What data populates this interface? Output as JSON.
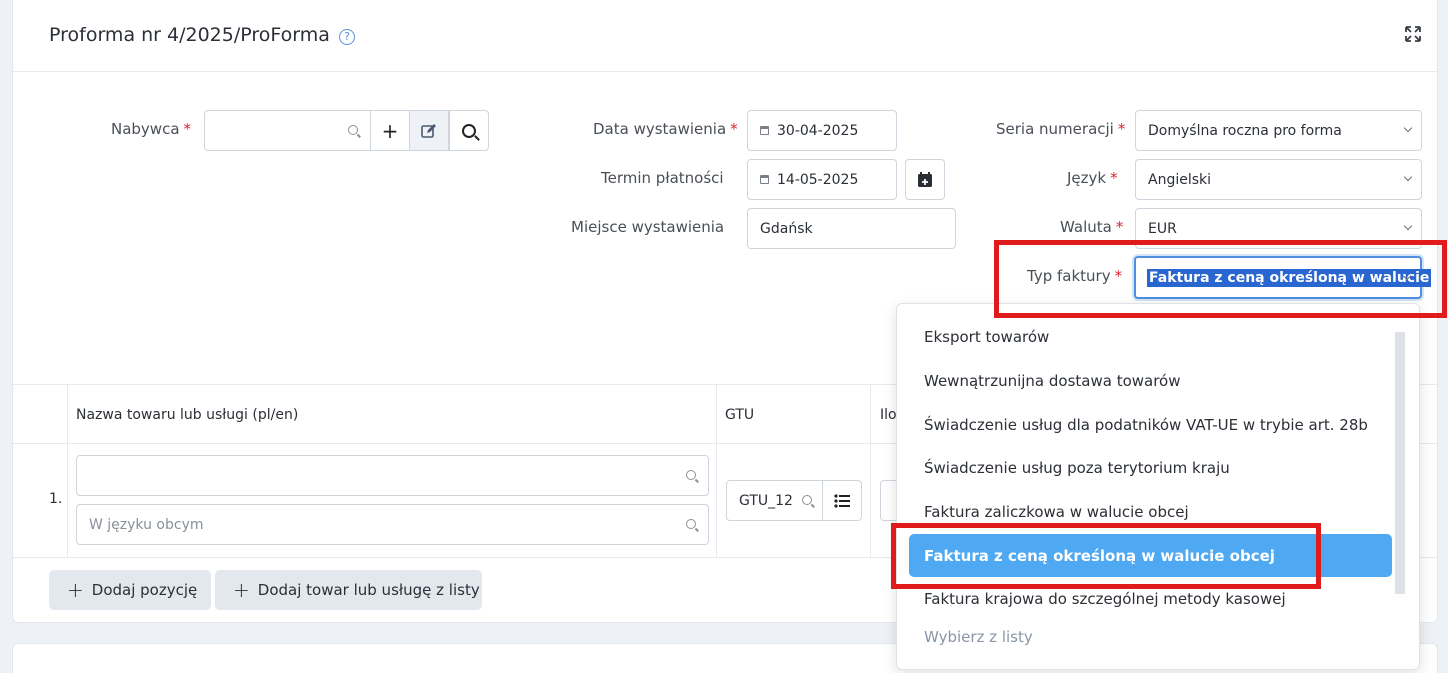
{
  "header": {
    "title": "Proforma nr 4/2025/ProForma"
  },
  "form": {
    "buyer": {
      "label": "Nabywca",
      "required": "*",
      "value": ""
    },
    "issue_date": {
      "label": "Data wystawienia",
      "required": "*",
      "value": "30-04-2025"
    },
    "due_date": {
      "label": "Termin płatności",
      "value": "14-05-2025"
    },
    "place": {
      "label": "Miejsce wystawienia",
      "value": "Gdańsk"
    },
    "series": {
      "label": "Seria numeracji",
      "required": "*",
      "value": "Domyślna roczna pro forma"
    },
    "language": {
      "label": "Język",
      "required": "*",
      "value": "Angielski"
    },
    "currency": {
      "label": "Waluta",
      "required": "*",
      "value": "EUR"
    },
    "invoice_type": {
      "label": "Typ faktury",
      "required": "*",
      "value": "Faktura z ceną określoną w walucie"
    }
  },
  "table": {
    "columns": [
      "Nazwa towaru lub usługi (pl/en)",
      "GTU",
      "Ilo"
    ],
    "row": {
      "index": "1.",
      "name_value": "",
      "foreign_placeholder": "W języku obcym",
      "gtu_value": "GTU_12"
    }
  },
  "actions": {
    "add_position": "Dodaj pozycję",
    "add_from_list": "Dodaj towar lub usługę z listy"
  },
  "dropdown": {
    "options": [
      "Eksport towarów",
      "Wewnątrzunijna dostawa towarów",
      "Świadczenie usług dla podatników VAT-UE w trybie art. 28b",
      "Świadczenie usług poza terytorium kraju",
      "Faktura zaliczkowa w walucie obcej",
      "Faktura z ceną określoną w walucie obcej",
      "Faktura krajowa do szczególnej metody kasowej"
    ],
    "selected": "Faktura z ceną określoną w walucie obcej",
    "footer": "Wybierz z listy"
  },
  "colors": {
    "accent": "#4ea8f2",
    "required": "#d9262c",
    "highlight": "#e01b1b"
  }
}
